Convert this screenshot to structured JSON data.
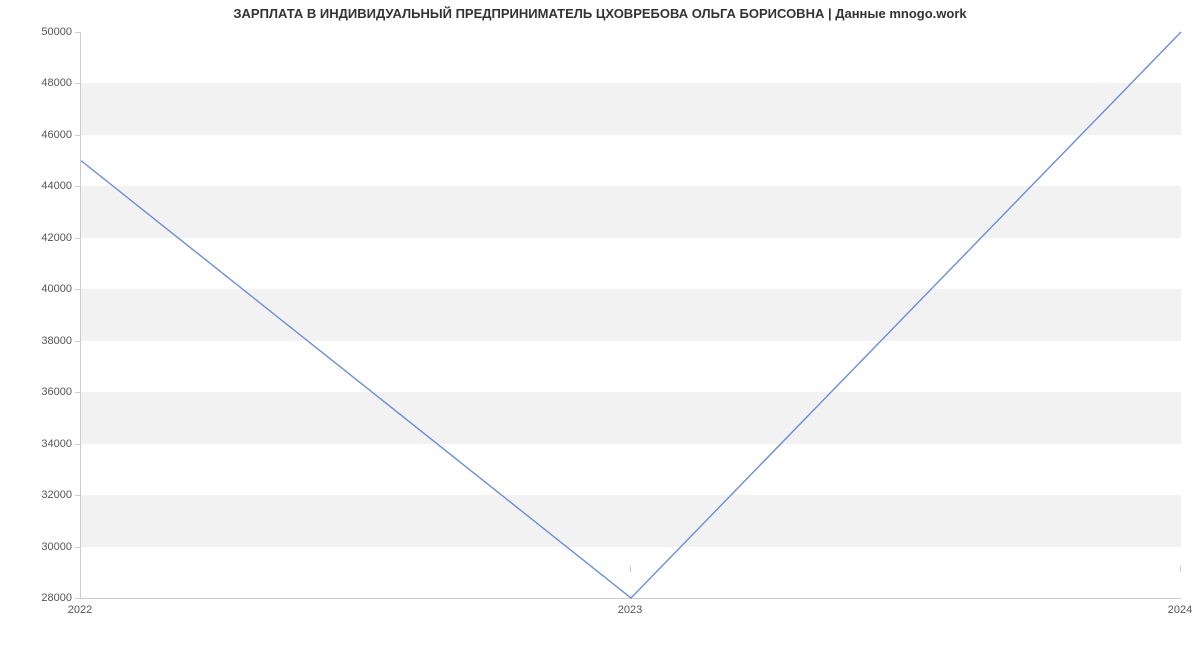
{
  "chart_data": {
    "type": "line",
    "title": "ЗАРПЛАТА В ИНДИВИДУАЛЬНЫЙ ПРЕДПРИНИМАТЕЛЬ ЦХОВРЕБОВА ОЛЬГА БОРИСОВНА | Данные mnogo.work",
    "x": [
      "2022",
      "2023",
      "2024"
    ],
    "values": [
      45000,
      28000,
      50000
    ],
    "xlabel": "",
    "ylabel": "",
    "ylim": [
      28000,
      50000
    ],
    "y_ticks": [
      28000,
      30000,
      32000,
      34000,
      36000,
      38000,
      40000,
      42000,
      44000,
      46000,
      48000,
      50000
    ],
    "x_ticks": [
      "2022",
      "2023",
      "2024"
    ],
    "line_color": "#6b8fd4",
    "band_color": "#f2f2f2"
  }
}
